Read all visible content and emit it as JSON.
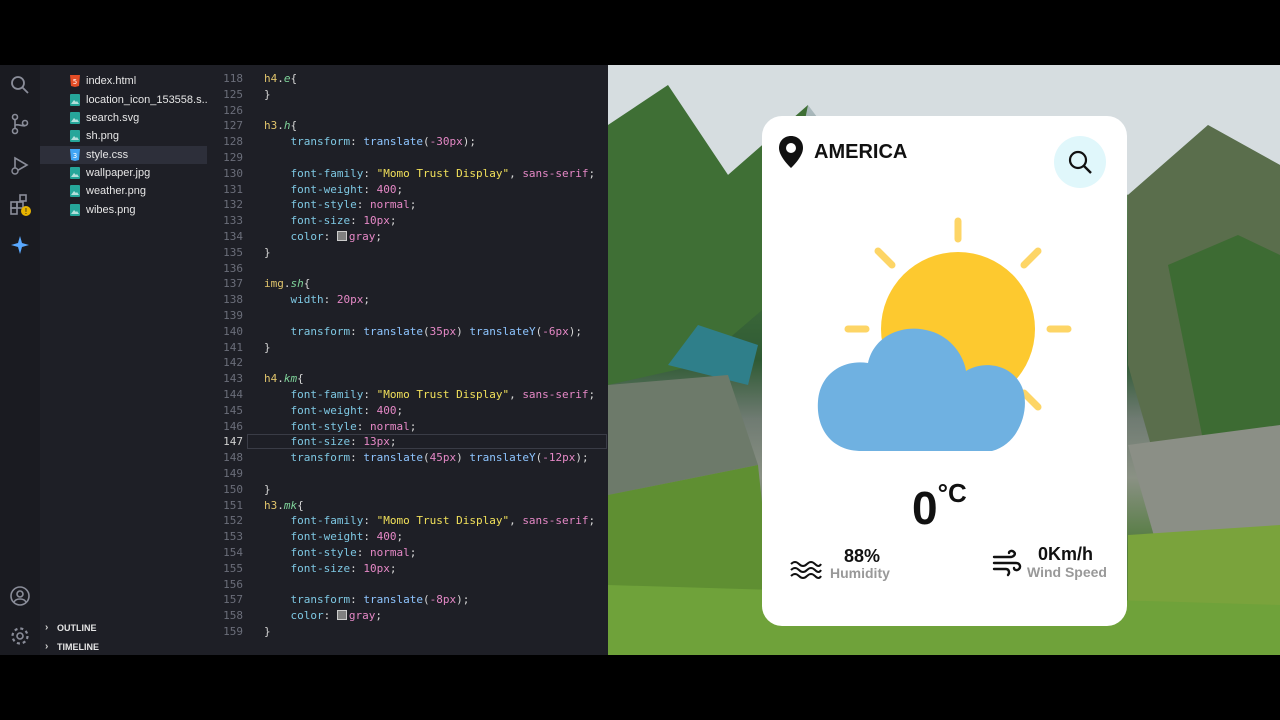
{
  "explorer": {
    "files": [
      {
        "name": "index.html",
        "icon": "html-file-icon",
        "color": "#e44d26"
      },
      {
        "name": "location_icon_153558.s...",
        "icon": "image-file-icon",
        "color": "#26a69a"
      },
      {
        "name": "search.svg",
        "icon": "image-file-icon",
        "color": "#26a69a"
      },
      {
        "name": "sh.png",
        "icon": "image-file-icon",
        "color": "#26a69a"
      },
      {
        "name": "style.css",
        "icon": "css-file-icon",
        "color": "#42a5f5"
      },
      {
        "name": "wallpaper.jpg",
        "icon": "image-file-icon",
        "color": "#26a69a"
      },
      {
        "name": "weather.png",
        "icon": "image-file-icon",
        "color": "#26a69a"
      },
      {
        "name": "wibes.png",
        "icon": "image-file-icon",
        "color": "#26a69a"
      }
    ],
    "sections": [
      "OUTLINE",
      "TIMELINE"
    ]
  },
  "code": {
    "current_line": 147,
    "lines": [
      {
        "n": 118,
        "text": "h4.e{"
      },
      {
        "n": 125,
        "text": "}"
      },
      {
        "n": 126,
        "text": ""
      },
      {
        "n": 127,
        "text": "h3.h{"
      },
      {
        "n": 128,
        "text": "    transform: translate(-30px);"
      },
      {
        "n": 129,
        "text": ""
      },
      {
        "n": 130,
        "text": "    font-family: \"Momo Trust Display\", sans-serif;"
      },
      {
        "n": 131,
        "text": "    font-weight: 400;"
      },
      {
        "n": 132,
        "text": "    font-style: normal;"
      },
      {
        "n": 133,
        "text": "    font-size: 10px;"
      },
      {
        "n": 134,
        "text": "    color: gray;"
      },
      {
        "n": 135,
        "text": "}"
      },
      {
        "n": 136,
        "text": ""
      },
      {
        "n": 137,
        "text": "img.sh{"
      },
      {
        "n": 138,
        "text": "    width: 20px;"
      },
      {
        "n": 139,
        "text": ""
      },
      {
        "n": 140,
        "text": "    transform: translate(35px) translateY(-6px);"
      },
      {
        "n": 141,
        "text": "}"
      },
      {
        "n": 142,
        "text": ""
      },
      {
        "n": 143,
        "text": "h4.km{"
      },
      {
        "n": 144,
        "text": "    font-family: \"Momo Trust Display\", sans-serif;"
      },
      {
        "n": 145,
        "text": "    font-weight: 400;"
      },
      {
        "n": 146,
        "text": "    font-style: normal;"
      },
      {
        "n": 147,
        "text": "    font-size: 13px;"
      },
      {
        "n": 148,
        "text": "    transform: translate(45px) translateY(-12px);"
      },
      {
        "n": 149,
        "text": ""
      },
      {
        "n": 150,
        "text": "}"
      },
      {
        "n": 151,
        "text": "h3.mk{"
      },
      {
        "n": 152,
        "text": "    font-family: \"Momo Trust Display\", sans-serif;"
      },
      {
        "n": 153,
        "text": "    font-weight: 400;"
      },
      {
        "n": 154,
        "text": "    font-style: normal;"
      },
      {
        "n": 155,
        "text": "    font-size: 10px;"
      },
      {
        "n": 156,
        "text": ""
      },
      {
        "n": 157,
        "text": "    transform: translate(-8px);"
      },
      {
        "n": 158,
        "text": "    color: gray;"
      },
      {
        "n": 159,
        "text": "}"
      }
    ]
  },
  "weather": {
    "city": "AMERICA",
    "temp_value": "0",
    "temp_unit": "°C",
    "humidity_value": "88%",
    "humidity_label": "Humidity",
    "wind_value": "0Km/h",
    "wind_label": "Wind Speed",
    "colors": {
      "sun": "#fdc92f",
      "cloud": "#6fb1e1",
      "search_bg": "#e0f7fb"
    }
  }
}
